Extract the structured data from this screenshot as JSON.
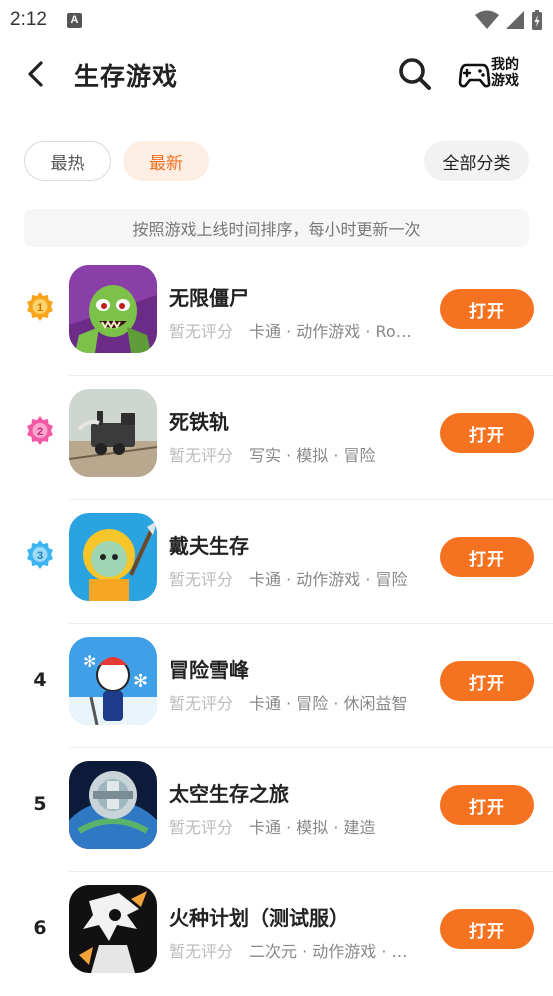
{
  "status_bar": {
    "time": "2:12",
    "notif_glyph": "A"
  },
  "header": {
    "title": "生存游戏",
    "my_games_label": "我的游戏"
  },
  "filters": {
    "hot": "最热",
    "new": "最新",
    "all_categories": "全部分类",
    "active": "new"
  },
  "banner": "按照游戏上线时间排序，每小时更新一次",
  "colors": {
    "accent": "#f57220",
    "pill_active_bg": "#fdeee3"
  },
  "games": [
    {
      "rank": "1",
      "rank_style": "medal-gold",
      "name": "无限僵尸",
      "rating": "暂无评分",
      "tags": "卡通 · 动作游戏 · Rog…",
      "button": "打开",
      "icon": "zombie-game-icon"
    },
    {
      "rank": "2",
      "rank_style": "medal-pink",
      "name": "死铁轨",
      "rating": "暂无评分",
      "tags": "写实 · 模拟 · 冒险",
      "button": "打开",
      "icon": "train-game-icon"
    },
    {
      "rank": "3",
      "rank_style": "medal-blue",
      "name": "戴夫生存",
      "rating": "暂无评分",
      "tags": "卡通 · 动作游戏 · 冒险",
      "button": "打开",
      "icon": "dave-game-icon"
    },
    {
      "rank": "4",
      "rank_style": "plain",
      "name": "冒险雪峰",
      "rating": "暂无评分",
      "tags": "卡通 · 冒险 · 休闲益智",
      "button": "打开",
      "icon": "snow-peak-game-icon"
    },
    {
      "rank": "5",
      "rank_style": "plain",
      "name": "太空生存之旅",
      "rating": "暂无评分",
      "tags": "卡通 · 模拟 · 建造",
      "button": "打开",
      "icon": "space-station-game-icon"
    },
    {
      "rank": "6",
      "rank_style": "plain",
      "name": "火种计划（测试服）",
      "rating": "暂无评分",
      "tags": "二次元 · 动作游戏 · 冒…",
      "button": "打开",
      "icon": "spark-project-game-icon"
    }
  ]
}
